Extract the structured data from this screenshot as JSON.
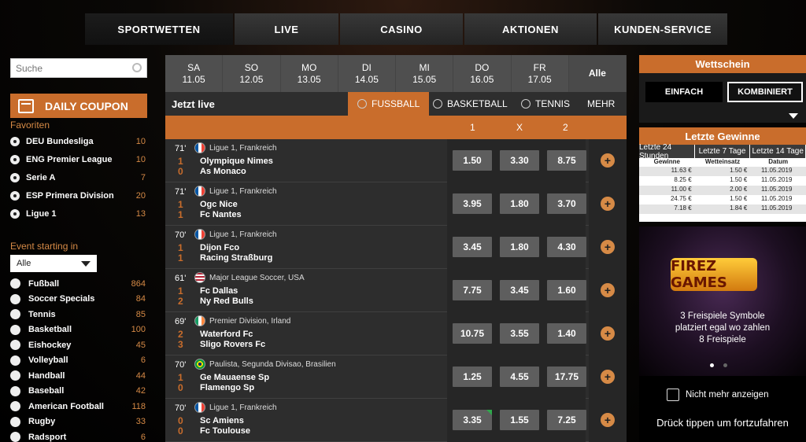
{
  "nav": [
    "SPORTWETTEN",
    "LIVE",
    "CASINO",
    "AKTIONEN",
    "KUNDEN-SERVICE"
  ],
  "search": {
    "placeholder": "Suche"
  },
  "coupon": {
    "label": "DAILY COUPON"
  },
  "favorites": {
    "title": "Favoriten",
    "items": [
      {
        "name": "DEU Bundesliga",
        "count": "10"
      },
      {
        "name": "ENG Premier League",
        "count": "10"
      },
      {
        "name": "Serie A",
        "count": "7"
      },
      {
        "name": "ESP Primera Division",
        "count": "20"
      },
      {
        "name": "Ligue 1",
        "count": "13"
      }
    ]
  },
  "event_starting": {
    "title": "Event starting in",
    "selected": "Alle"
  },
  "sports": [
    {
      "name": "Fußball",
      "count": "864"
    },
    {
      "name": "Soccer Specials",
      "count": "84"
    },
    {
      "name": "Tennis",
      "count": "85"
    },
    {
      "name": "Basketball",
      "count": "100"
    },
    {
      "name": "Eishockey",
      "count": "45"
    },
    {
      "name": "Volleyball",
      "count": "6"
    },
    {
      "name": "Handball",
      "count": "44"
    },
    {
      "name": "Baseball",
      "count": "42"
    },
    {
      "name": "American Football",
      "count": "118"
    },
    {
      "name": "Rugby",
      "count": "33"
    },
    {
      "name": "Radsport",
      "count": "6"
    }
  ],
  "dates": [
    {
      "day": "SA",
      "date": "11.05"
    },
    {
      "day": "SO",
      "date": "12.05"
    },
    {
      "day": "MO",
      "date": "13.05"
    },
    {
      "day": "DI",
      "date": "14.05"
    },
    {
      "day": "MI",
      "date": "15.05"
    },
    {
      "day": "DO",
      "date": "16.05"
    },
    {
      "day": "FR",
      "date": "17.05"
    }
  ],
  "dates_all": "Alle",
  "live": {
    "title": "Jetzt live",
    "tabs": [
      "FUSSBALL",
      "BASKETBALL",
      "TENNIS",
      "MEHR"
    ]
  },
  "odds_header": [
    "1",
    "X",
    "2"
  ],
  "matches": [
    {
      "min": "71'",
      "league": "Ligue 1, Frankreich",
      "flag": "fr",
      "s1": "1",
      "s2": "0",
      "t1": "Olympique Nimes",
      "t2": "As Monaco",
      "o": [
        "1.50",
        "3.30",
        "8.75"
      ]
    },
    {
      "min": "71'",
      "league": "Ligue 1, Frankreich",
      "flag": "fr",
      "s1": "1",
      "s2": "1",
      "t1": "Ogc Nice",
      "t2": "Fc Nantes",
      "o": [
        "3.95",
        "1.80",
        "3.70"
      ]
    },
    {
      "min": "70'",
      "league": "Ligue 1, Frankreich",
      "flag": "fr",
      "s1": "1",
      "s2": "1",
      "t1": "Dijon Fco",
      "t2": "Racing Straßburg",
      "o": [
        "3.45",
        "1.80",
        "4.30"
      ]
    },
    {
      "min": "61'",
      "league": "Major League Soccer, USA",
      "flag": "us",
      "s1": "1",
      "s2": "2",
      "t1": "Fc Dallas",
      "t2": "Ny Red Bulls",
      "o": [
        "7.75",
        "3.45",
        "1.60"
      ]
    },
    {
      "min": "69'",
      "league": "Premier Division, Irland",
      "flag": "ie",
      "s1": "2",
      "s2": "3",
      "t1": "Waterford Fc",
      "t2": "Sligo Rovers Fc",
      "o": [
        "10.75",
        "3.55",
        "1.40"
      ]
    },
    {
      "min": "70'",
      "league": "Paulista, Segunda Divisao, Brasilien",
      "flag": "br",
      "s1": "1",
      "s2": "0",
      "t1": "Ge Mauaense Sp",
      "t2": "Flamengo Sp",
      "o": [
        "1.25",
        "4.55",
        "17.75"
      ]
    },
    {
      "min": "70'",
      "league": "Ligue 1, Frankreich",
      "flag": "fr",
      "s1": "0",
      "s2": "0",
      "t1": "Sc Amiens",
      "t2": "Fc Toulouse",
      "o": [
        "3.35",
        "1.55",
        "7.25"
      ]
    }
  ],
  "wettschein": {
    "title": "Wettschein",
    "einfach": "EINFACH",
    "kombiniert": "KOMBINIERT"
  },
  "gewinne": {
    "title": "Letzte Gewinne",
    "tabs": [
      "Letzte 24 Stunden",
      "Letzte 7 Tage",
      "Letzte 14 Tage"
    ],
    "cols": [
      "Gewinne",
      "Wetteinsatz",
      "Datum"
    ],
    "rows": [
      [
        "11.63 €",
        "1.50 €",
        "11.05.2019"
      ],
      [
        "8.25 €",
        "1.50 €",
        "11.05.2019"
      ],
      [
        "11.00 €",
        "2.00 €",
        "11.05.2019"
      ],
      [
        "24.75 €",
        "1.50 €",
        "11.05.2019"
      ],
      [
        "7.18 €",
        "1.84 €",
        "11.05.2019"
      ]
    ]
  },
  "promo": {
    "logo": "FIREZ GAMES",
    "line1": "3 Freispiele Symbole",
    "line2": "platziert egal wo zahlen",
    "line3": "8 Freispiele",
    "checkbox": "Nicht mehr anzeigen",
    "tap": "Drück tippen um fortzufahren"
  }
}
